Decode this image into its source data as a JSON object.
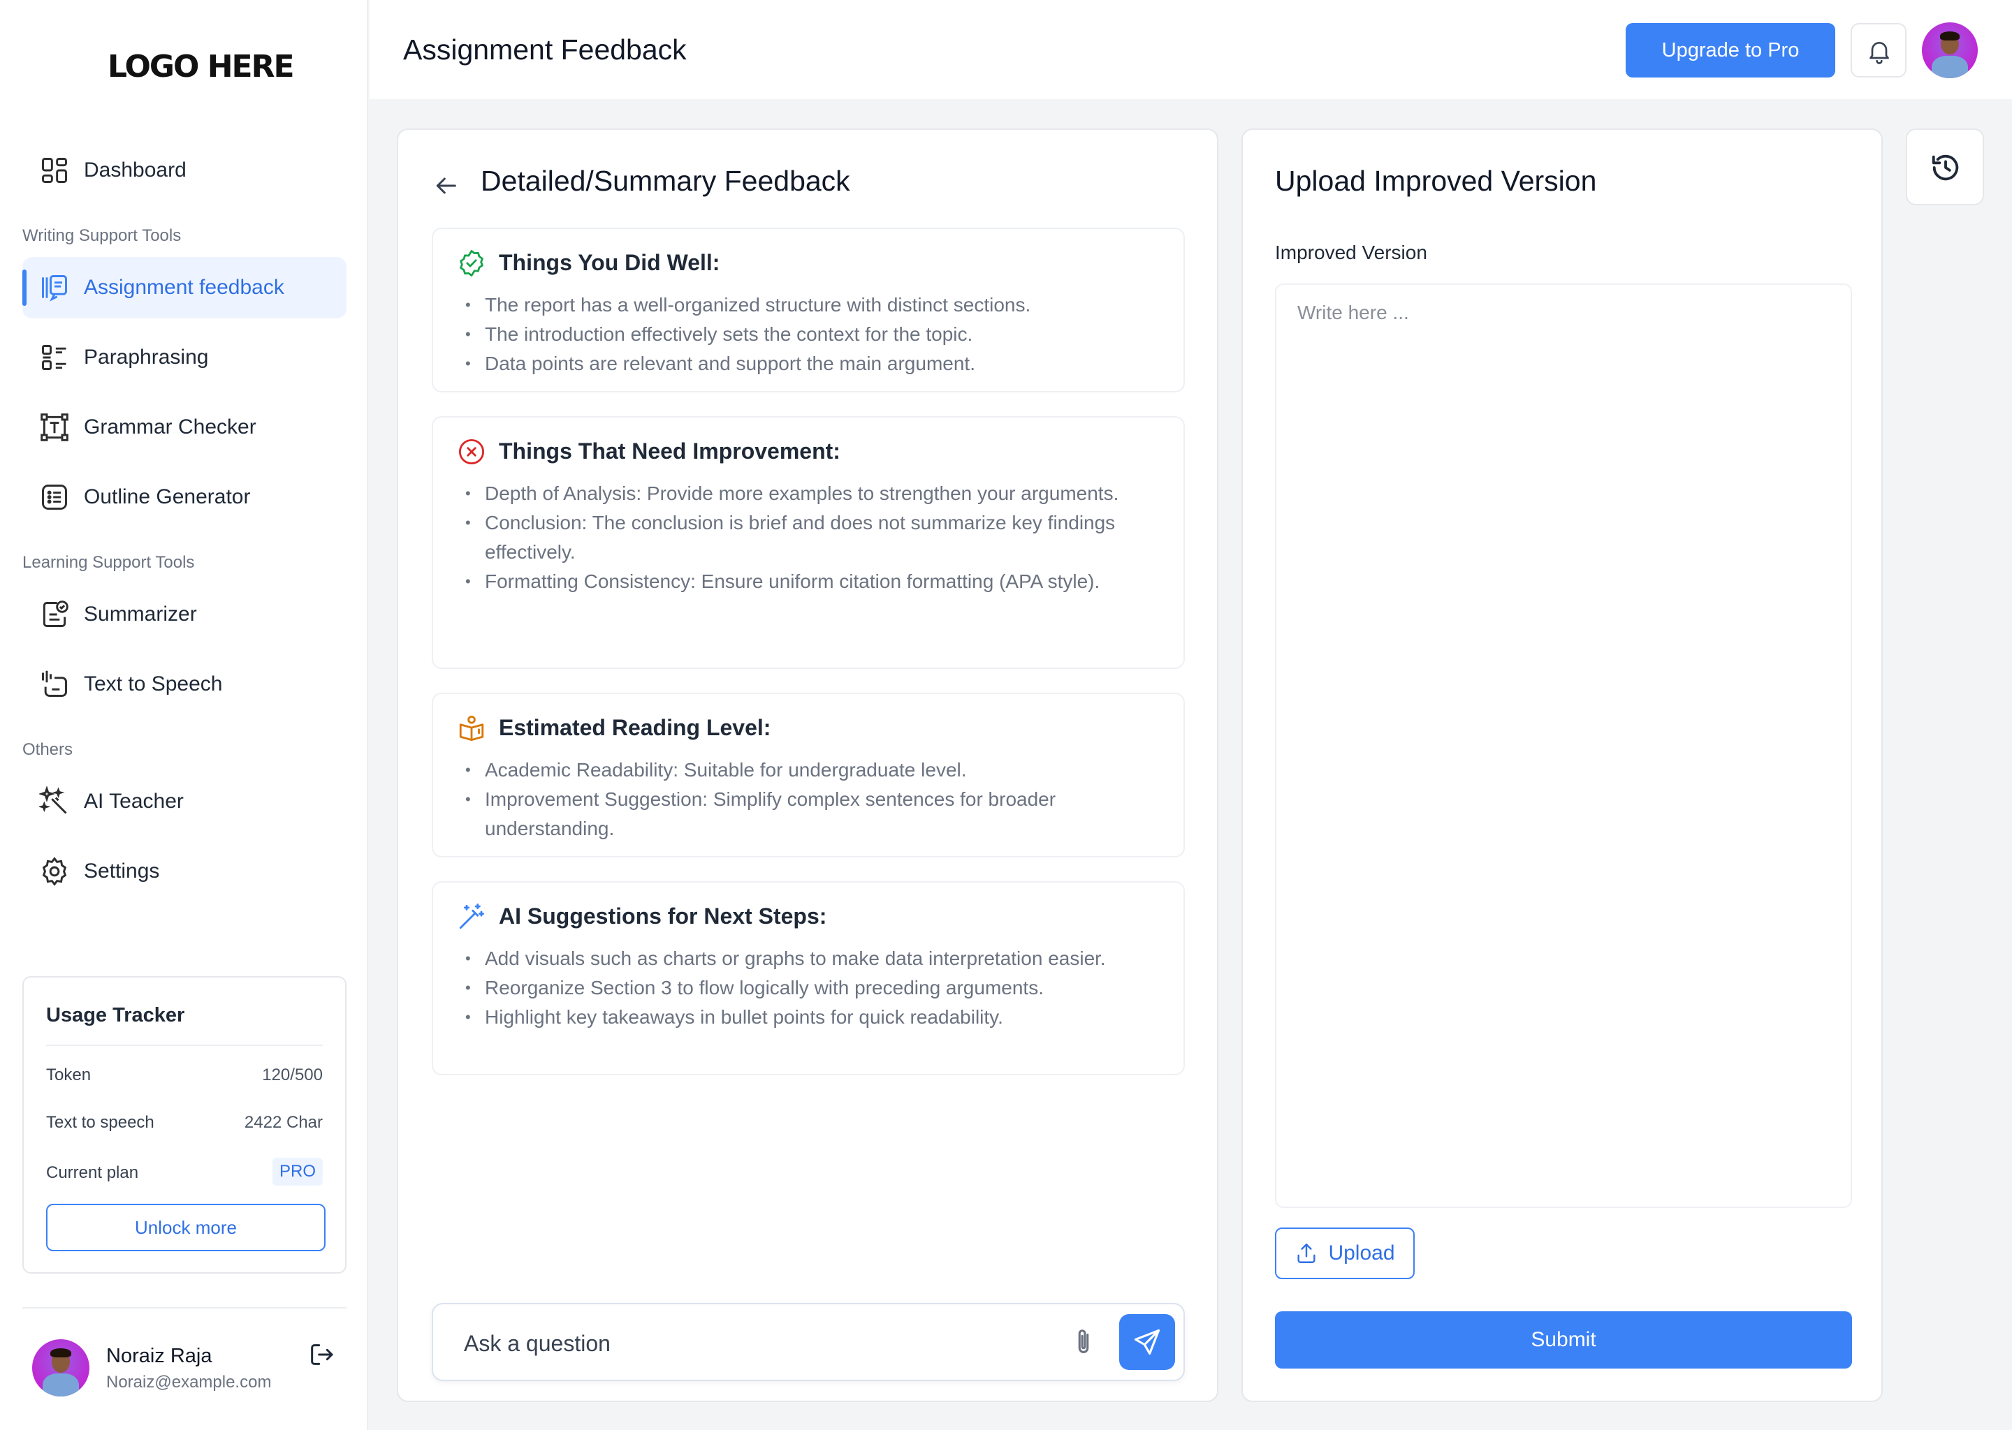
{
  "app": {
    "logo": "LOGO HERE",
    "page_title": "Assignment Feedback",
    "upgrade_label": "Upgrade to Pro"
  },
  "sidebar": {
    "dashboard": "Dashboard",
    "writing_section": "Writing Support Tools",
    "writing_items": [
      "Assignment feedback",
      "Paraphrasing",
      "Grammar Checker",
      "Outline Generator"
    ],
    "learning_section": "Learning Support Tools",
    "learning_items": [
      "Summarizer",
      "Text to Speech"
    ],
    "others_section": "Others",
    "other_items": [
      "AI Teacher",
      "Settings"
    ],
    "active_item": "Assignment feedback"
  },
  "usage": {
    "title": "Usage Tracker",
    "rows": [
      {
        "label": "Token",
        "value": "120/500"
      },
      {
        "label": "Text to speech",
        "value": "2422 Char"
      },
      {
        "label": "Current plan",
        "value": "PRO"
      }
    ],
    "unlock_label": "Unlock more"
  },
  "profile": {
    "name": "Noraiz Raja",
    "email": "Noraiz@example.com"
  },
  "feedback": {
    "title": "Detailed/Summary Feedback",
    "cards": [
      {
        "title": "Things You Did Well:",
        "icon": "check-badge-icon",
        "color": "#16a34a",
        "items": [
          "The report has a well-organized structure with distinct sections.",
          "The introduction effectively sets the context for the topic.",
          "Data points are relevant and support the main argument."
        ]
      },
      {
        "title": "Things That Need Improvement:",
        "icon": "x-circle-icon",
        "color": "#dc2626",
        "items": [
          "Depth of Analysis: Provide more examples to strengthen your arguments.",
          "Conclusion: The conclusion is brief and does not summarize key findings effectively.",
          "Formatting Consistency: Ensure uniform citation formatting (APA style)."
        ]
      },
      {
        "title": "Estimated Reading Level:",
        "icon": "book-reader-icon",
        "color": "#d97706",
        "items": [
          "Academic Readability: Suitable for undergraduate level.",
          "Improvement Suggestion: Simplify complex sentences for broader understanding."
        ]
      },
      {
        "title": "AI Suggestions for Next Steps:",
        "icon": "magic-wand-icon",
        "color": "#3b82f6",
        "items": [
          "Add visuals such as charts or graphs to make data interpretation easier.",
          "Reorganize Section 3 to flow logically with preceding arguments.",
          "Highlight key takeaways in bullet points for quick readability."
        ]
      }
    ],
    "ask_placeholder": "Ask a question"
  },
  "upload": {
    "title": "Upload Improved Version",
    "field_label": "Improved Version",
    "placeholder": "Write here ...",
    "upload_label": "Upload",
    "submit_label": "Submit"
  },
  "colors": {
    "accent": "#3b82f6",
    "active_bg": "#eef4ff"
  }
}
